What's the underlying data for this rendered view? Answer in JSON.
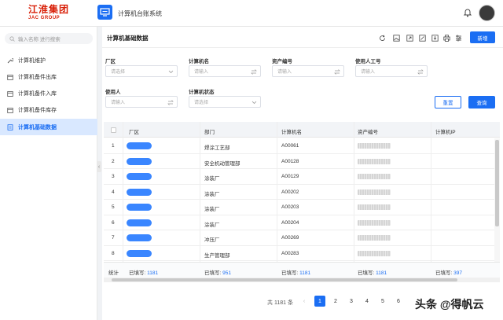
{
  "header": {
    "logo_cn": "江淮集团",
    "logo_en": "JAC GROUP",
    "app_title": "计算机台账系统",
    "accent": "#1b6ef3"
  },
  "sidebar": {
    "search_placeholder": "输入名称 进行搜索",
    "items": [
      {
        "label": "计算机维护",
        "icon": "wrench-icon"
      },
      {
        "label": "计算机备件出库",
        "icon": "calendar-icon"
      },
      {
        "label": "计算机备件入库",
        "icon": "calendar-icon"
      },
      {
        "label": "计算机备件库存",
        "icon": "calendar-icon"
      },
      {
        "label": "计算机基础数据",
        "icon": "document-icon",
        "active": true
      }
    ]
  },
  "main": {
    "title": "计算机基础数据",
    "new_button": "新增",
    "reset_button": "重置",
    "query_button": "查询"
  },
  "filters": {
    "factory": {
      "label": "厂区",
      "placeholder": "请选择"
    },
    "computer_name": {
      "label": "计算机名",
      "placeholder": "请输入"
    },
    "asset_no": {
      "label": "资产编号",
      "placeholder": "请输入"
    },
    "user_id": {
      "label": "使用人工号",
      "placeholder": "请输入"
    },
    "user": {
      "label": "使用人",
      "placeholder": "请输入"
    },
    "status": {
      "label": "计算机状态",
      "placeholder": "请选择"
    }
  },
  "table": {
    "headers": [
      "厂区",
      "部门",
      "计算机名",
      "资产编号",
      "计算机IP"
    ],
    "rows": [
      {
        "no": "1",
        "dept": "焊涂工艺部",
        "name": "A00061"
      },
      {
        "no": "2",
        "dept": "安全机动管理部",
        "name": "A00128"
      },
      {
        "no": "3",
        "dept": "涂装厂",
        "name": "A00129"
      },
      {
        "no": "4",
        "dept": "涂装厂",
        "name": "A00202"
      },
      {
        "no": "5",
        "dept": "涂装厂",
        "name": "A00203"
      },
      {
        "no": "6",
        "dept": "涂装厂",
        "name": "A00204"
      },
      {
        "no": "7",
        "dept": "冲压厂",
        "name": "A00269"
      },
      {
        "no": "8",
        "dept": "生产管理部",
        "name": "A00283"
      }
    ],
    "summary": {
      "label": "统计",
      "filled_prefix": "已填写:",
      "factory": "1181",
      "dept": "951",
      "name": "1181",
      "asset": "1181",
      "ip": "397"
    }
  },
  "pagination": {
    "total": "共 1181 条",
    "pages": [
      "1",
      "2",
      "3",
      "4",
      "5",
      "6"
    ],
    "current": "1"
  },
  "watermark": "头条 @得帆云"
}
